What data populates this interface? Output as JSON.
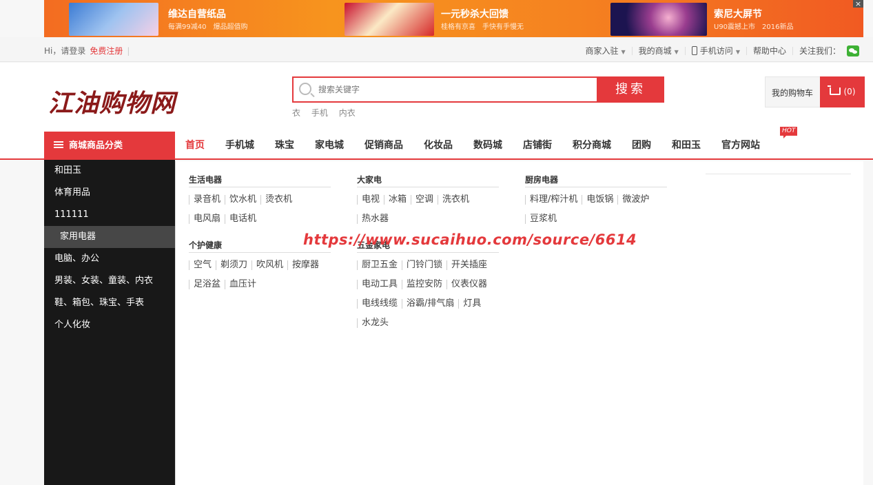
{
  "banner": {
    "ads": [
      {
        "title": "维达自营纸品",
        "sub": "每满99减40　爆品超值购"
      },
      {
        "title": "一元秒杀大回馈",
        "sub": "桂格有京喜　手快有手慢无"
      },
      {
        "title": "索尼大屏节",
        "sub": "U90震撼上市　2016新品"
      }
    ],
    "close_label": "×",
    "colors": {
      "accent": "#f36c21"
    }
  },
  "topbar": {
    "greeting": "Hi，请登录",
    "register": "免费注册",
    "sep": "|",
    "right_items": [
      "商家入驻",
      "我的商城",
      "手机访问",
      "帮助中心",
      "关注我们："
    ]
  },
  "header": {
    "logo_text": "江油购物网",
    "search_placeholder": "搜索关键字",
    "search_button": "搜索",
    "hot_words": [
      "衣",
      "手机",
      "内衣"
    ],
    "cart_label": "我的购物车",
    "cart_count": "(0)"
  },
  "nav": {
    "category_label": "商城商品分类",
    "items": [
      "首页",
      "手机城",
      "珠宝",
      "家电城",
      "促销商品",
      "化妆品",
      "数码城",
      "店铺街",
      "积分商城",
      "团购",
      "和田玉",
      "官方网站"
    ],
    "hot_badge": "HOT",
    "colors": {
      "brand": "#e4393c"
    }
  },
  "sidebar": {
    "categories": [
      "和田玉",
      "体育用品",
      "111111",
      "家用电器",
      "电脑、办公",
      "男装、女装、童装、内衣",
      "鞋、箱包、珠宝、手表",
      "个人化妆"
    ],
    "selected": "家用电器"
  },
  "panel": {
    "groups": [
      {
        "title": "生活电器",
        "items": [
          "录音机",
          "饮水机",
          "烫衣机",
          "电风扇",
          "电话机"
        ]
      },
      {
        "title": "大家电",
        "items": [
          "电视",
          "冰箱",
          "空调",
          "洗衣机",
          "热水器"
        ]
      },
      {
        "title": "厨房电器",
        "items": [
          "料理/榨汁机",
          "电饭锅",
          "微波炉",
          "豆浆机"
        ]
      },
      {
        "title": "个护健康",
        "items": [
          "空气",
          "剃须刀",
          "吹风机",
          "按摩器",
          "足浴盆",
          "血压计"
        ]
      },
      {
        "title": "五金家电",
        "items": [
          "厨卫五金",
          "门铃门锁",
          "开关插座",
          "电动工具",
          "监控安防",
          "仪表仪器",
          "电线线缆",
          "浴霸/排气扇",
          "灯具",
          "水龙头"
        ]
      }
    ]
  },
  "watermark": "https://www.sucaihuo.com/source/6614"
}
